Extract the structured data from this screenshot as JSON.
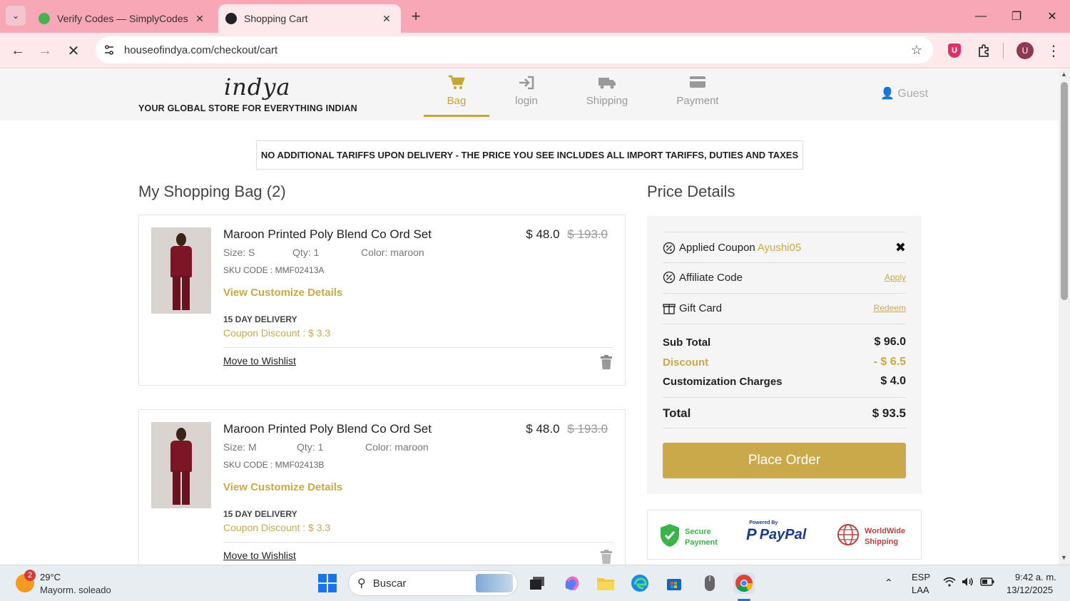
{
  "browser": {
    "tabs": [
      {
        "title": "Verify Codes — SimplyCodes",
        "active": false
      },
      {
        "title": "Shopping Cart",
        "active": true
      }
    ],
    "url": "houseofindya.com/checkout/cart",
    "profile_initial": "U",
    "extension_badge": "U"
  },
  "header": {
    "logo": "indya",
    "tagline": "YOUR GLOBAL STORE FOR EVERYTHING INDIAN",
    "steps": [
      {
        "label": "Bag",
        "icon": "cart-icon",
        "active": true
      },
      {
        "label": "login",
        "icon": "sign-in-icon",
        "active": false
      },
      {
        "label": "Shipping",
        "icon": "truck-icon",
        "active": false
      },
      {
        "label": "Payment",
        "icon": "card-icon",
        "active": false
      }
    ],
    "guest": "Guest"
  },
  "banner": "NO ADDITIONAL TARIFFS UPON DELIVERY - THE PRICE YOU SEE INCLUDES ALL IMPORT TARIFFS, DUTIES AND TAXES",
  "bag": {
    "title": "My Shopping Bag (2)",
    "items": [
      {
        "name": "Maroon Printed Poly Blend Co Ord Set",
        "price": "$ 48.0",
        "old_price": "$ 193.0",
        "size": "Size: S",
        "qty": "Qty: 1",
        "color": "Color: maroon",
        "sku": "SKU CODE : MMF02413A",
        "customize": "View Customize Details",
        "delivery": "15 DAY DELIVERY",
        "coupon": "Coupon Discount : $ 3.3",
        "wishlist": "Move to Wishlist"
      },
      {
        "name": "Maroon Printed Poly Blend Co Ord Set",
        "price": "$ 48.0",
        "old_price": "$ 193.0",
        "size": "Size: M",
        "qty": "Qty: 1",
        "color": "Color: maroon",
        "sku": "SKU CODE : MMF02413B",
        "customize": "View Customize Details",
        "delivery": "15 DAY DELIVERY",
        "coupon": "Coupon Discount : $ 3.3",
        "wishlist": "Move to Wishlist"
      }
    ]
  },
  "price": {
    "title": "Price Details",
    "applied_coupon_label": "Applied Coupon",
    "applied_coupon_code": "Ayushi05",
    "affiliate_label": "Affiliate Code",
    "affiliate_action": "Apply",
    "gift_label": "Gift Card",
    "gift_action": "Redeem",
    "subtotal_label": "Sub Total",
    "subtotal": "$ 96.0",
    "discount_label": "Discount",
    "discount": "- $ 6.5",
    "custom_label": "Customization Charges",
    "custom": "$ 4.0",
    "total_label": "Total",
    "total": "$ 93.5",
    "place_order": "Place Order"
  },
  "trust": {
    "secure_line1": "Secure",
    "secure_line2": "Payment",
    "paypal_small": "Powered By",
    "paypal": "PayPal",
    "world_line1": "WorldWide",
    "world_line2": "Shipping"
  },
  "taskbar": {
    "weather_badge": "2",
    "temp": "29°C",
    "weather_desc": "Mayorm. soleado",
    "search": "Buscar",
    "lang1": "ESP",
    "lang2": "LAA",
    "time": "9:42 a. m.",
    "date": "13/12/2025"
  },
  "colors": {
    "accent_gold": "#c9a94a",
    "tab_bar": "#f8a7b6",
    "toolbar": "#fde8ec"
  }
}
